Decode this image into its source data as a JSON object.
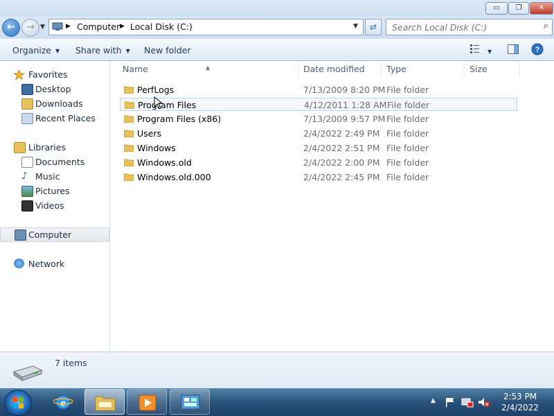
{
  "window": {
    "controls": {
      "minimize": "▭",
      "maximize": "❐",
      "close": "✕"
    }
  },
  "address": {
    "crumbs": [
      "Computer",
      "Local Disk (C:)"
    ],
    "search_placeholder": "Search Local Disk (C:)"
  },
  "toolbar": {
    "organize": "Organize",
    "share_with": "Share with",
    "new_folder": "New folder"
  },
  "nav": {
    "favorites": "Favorites",
    "favorites_items": [
      "Desktop",
      "Downloads",
      "Recent Places"
    ],
    "libraries": "Libraries",
    "libraries_items": [
      "Documents",
      "Music",
      "Pictures",
      "Videos"
    ],
    "computer": "Computer",
    "network": "Network"
  },
  "columns": {
    "name": "Name",
    "date": "Date modified",
    "type": "Type",
    "size": "Size"
  },
  "files": [
    {
      "name": "PerfLogs",
      "date": "7/13/2009 8:20 PM",
      "type": "File folder"
    },
    {
      "name": "Program Files",
      "date": "4/12/2011 1:28 AM",
      "type": "File folder"
    },
    {
      "name": "Program Files (x86)",
      "date": "7/13/2009 9:57 PM",
      "type": "File folder"
    },
    {
      "name": "Users",
      "date": "2/4/2022 2:49 PM",
      "type": "File folder"
    },
    {
      "name": "Windows",
      "date": "2/4/2022 2:51 PM",
      "type": "File folder"
    },
    {
      "name": "Windows.old",
      "date": "2/4/2022 2:00 PM",
      "type": "File folder"
    },
    {
      "name": "Windows.old.000",
      "date": "2/4/2022 2:45 PM",
      "type": "File folder"
    }
  ],
  "status": {
    "item_count": "7 items"
  },
  "taskbar": {
    "time": "2:53 PM",
    "date": "2/4/2022"
  },
  "colors": {
    "accent": "#2a6fc0",
    "folder": "#e8c15a",
    "taskbar": "#2a527a"
  }
}
